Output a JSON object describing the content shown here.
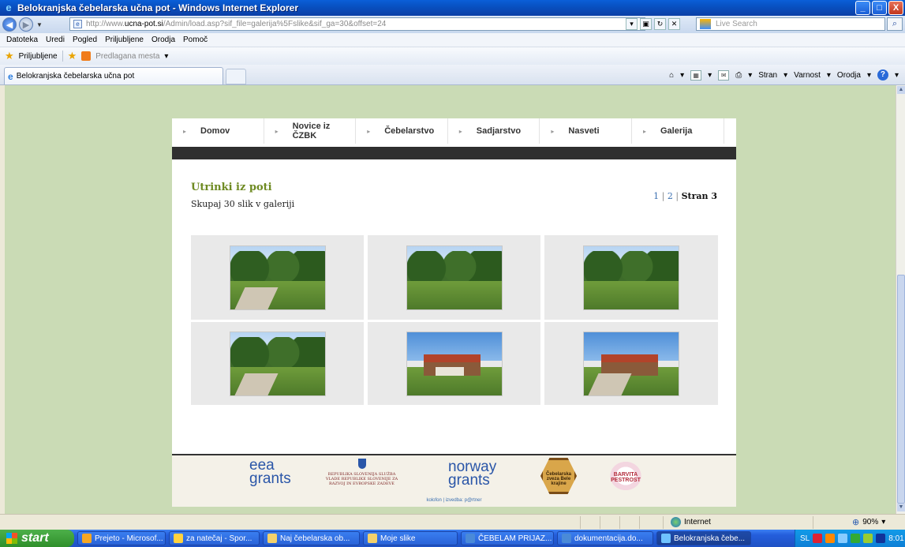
{
  "window": {
    "title": "Belokranjska čebelarska učna pot - Windows Internet Explorer",
    "minimize_glyph": "_",
    "maximize_glyph": "□",
    "close_glyph": "X"
  },
  "address": {
    "url_prefix": "http://www.",
    "url_host": "ucna-pot.si",
    "url_rest": "/Admin/load.asp?sif_file=galerija%5Fslike&sif_ga=30&offset=24",
    "search_placeholder": "Live Search"
  },
  "menu": [
    "Datoteka",
    "Uredi",
    "Pogled",
    "Priljubljene",
    "Orodja",
    "Pomoč"
  ],
  "favorites": {
    "label": "Priljubljene",
    "suggested": "Predlagana mesta"
  },
  "tab": {
    "title": "Belokranjska čebelarska učna pot"
  },
  "command_bar": {
    "page": "Stran",
    "safety": "Varnost",
    "tools": "Orodja"
  },
  "site": {
    "nav": [
      "Domov",
      "Novice iz ČZBK",
      "Čebelarstvo",
      "Sadjarstvo",
      "Nasveti",
      "Galerija"
    ],
    "gallery_title": "Utrinki iz poti",
    "gallery_count": "Skupaj 30 slik v galeriji",
    "pager": {
      "page1": "1",
      "page2": "2",
      "current": "Stran 3",
      "separator": "|"
    },
    "photos": [
      {
        "scene": "path"
      },
      {
        "scene": "meadow"
      },
      {
        "scene": "meadow"
      },
      {
        "scene": "path"
      },
      {
        "scene": "house"
      },
      {
        "scene": "house"
      }
    ],
    "footer": {
      "eea_line1": "eea",
      "eea_line2": "grants",
      "gov_text": "REPUBLIKA SLOVENIJA SLUŽBA VLADE REPUBLIKE SLOVENIJE ZA RAZVOJ IN EVROPSKE ZADEVE",
      "norway_line1": "norway",
      "norway_line2": "grants",
      "bees_text": "Čebelarska zveza Bele krajine",
      "pestrost_text": "BARVITA PESTROST",
      "credits": "kolofon | izvedba: p@rtner"
    }
  },
  "status": {
    "zone": "Internet",
    "zoom": "90%"
  },
  "taskbar": {
    "start": "start",
    "tasks": [
      "Prejeto - Microsof...",
      "za natečaj - Spor...",
      "Naj čebelarska ob...",
      "Moje slike",
      "ČEBELAM PRIJAZ...",
      "dokumentacija.do...",
      "Belokranjska čebe..."
    ],
    "tray_lang": "SL",
    "clock": "8:01"
  }
}
